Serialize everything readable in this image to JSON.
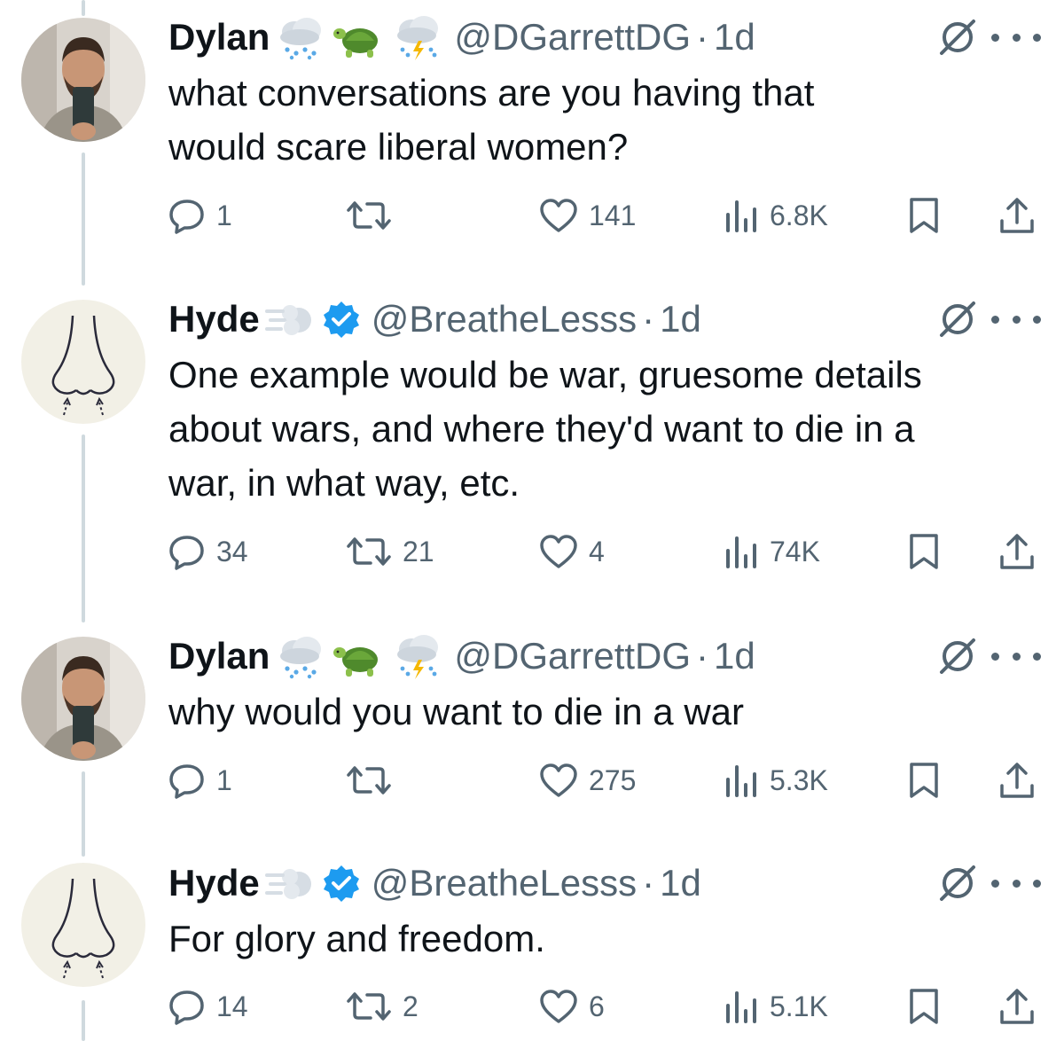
{
  "tweets": [
    {
      "name": "Dylan",
      "emojis": [
        "rain-cloud-emoji",
        "turtle-emoji",
        "thunder-cloud-emoji"
      ],
      "handle": "@DGarrettDG",
      "separator": "·",
      "time": "1d",
      "text_lines": [
        "what conversations are you having that",
        "would scare liberal women?"
      ],
      "replies": "1",
      "retweets": "",
      "likes": "141",
      "views": "6.8K",
      "avatar": "man-selfie-avatar"
    },
    {
      "name": "Hyde",
      "emojis": [
        "dash-emoji",
        "verified-badge-icon"
      ],
      "handle": "@BreatheLesss",
      "separator": "·",
      "time": "1d",
      "text_lines": [
        "One example would be war, gruesome details",
        "about wars, and where they'd want to die in a",
        "war, in what way, etc."
      ],
      "replies": "34",
      "retweets": "21",
      "likes": "4",
      "views": "74K",
      "avatar": "nose-drawing-avatar"
    },
    {
      "name": "Dylan",
      "emojis": [
        "rain-cloud-emoji",
        "turtle-emoji",
        "thunder-cloud-emoji"
      ],
      "handle": "@DGarrettDG",
      "separator": "·",
      "time": "1d",
      "text_lines": [
        "why would you want to die in a war"
      ],
      "replies": "1",
      "retweets": "",
      "likes": "275",
      "views": "5.3K",
      "avatar": "man-selfie-avatar"
    },
    {
      "name": "Hyde",
      "emojis": [
        "dash-emoji",
        "verified-badge-icon"
      ],
      "handle": "@BreatheLesss",
      "separator": "·",
      "time": "1d",
      "text_lines": [
        "For glory and freedom."
      ],
      "replies": "14",
      "retweets": "2",
      "likes": "6",
      "views": "5.1K",
      "avatar": "nose-drawing-avatar"
    }
  ],
  "colors": {
    "text": "#0f1419",
    "secondary": "#536471",
    "thread_line": "#cfd9de",
    "verified": "#1d9bf0"
  }
}
